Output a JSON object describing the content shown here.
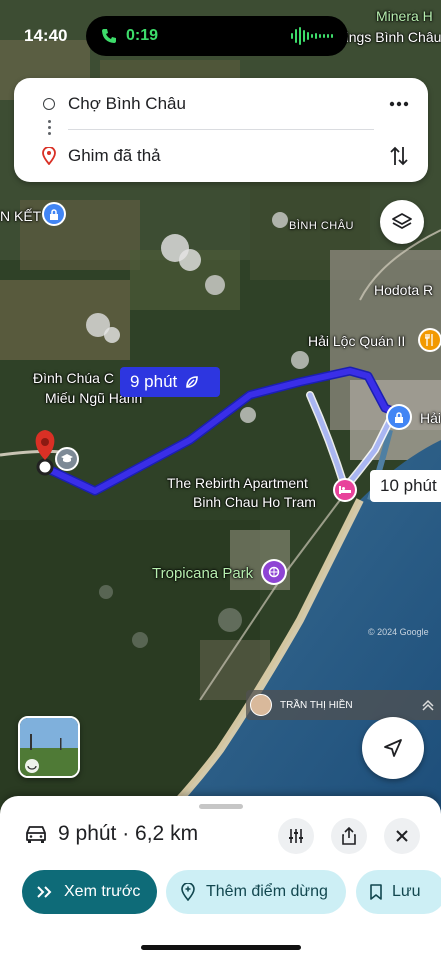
{
  "status": {
    "time": "14:40",
    "call_duration": "0:19"
  },
  "route": {
    "origin": "Chợ Bình Châu",
    "destination": "Ghim đã thả"
  },
  "map": {
    "labels": {
      "minera": "Minera H",
      "binh_chau_top": "rings Bình Châu",
      "ket": "N KẾT",
      "binh_chau_area": "BÌNH CHÂU",
      "hodota": "Hodota R",
      "hai_loc": "Hải Lộc Quán II",
      "dinh_chua": "Đình Chúa C",
      "mieu": "Miếu Ngũ Hành",
      "hai": "Hải",
      "rebirth_1": "The Rebirth Apartment",
      "rebirth_2": "Binh Chau Ho Tram",
      "tropicana": "Tropicana Park",
      "watermark": "© 2024 Google"
    },
    "primary_time": "9 phút",
    "alt_time": "10 phút",
    "contributor": "TRẦN THỊ HIỀN",
    "colors": {
      "route": "#3a2ee8",
      "alt_route": "#a9b6f2"
    }
  },
  "sheet": {
    "summary": "9 phút · 6,2 km",
    "buttons": {
      "preview": "Xem trước",
      "add_stop": "Thêm điểm dừng",
      "save": "Lưu"
    }
  }
}
